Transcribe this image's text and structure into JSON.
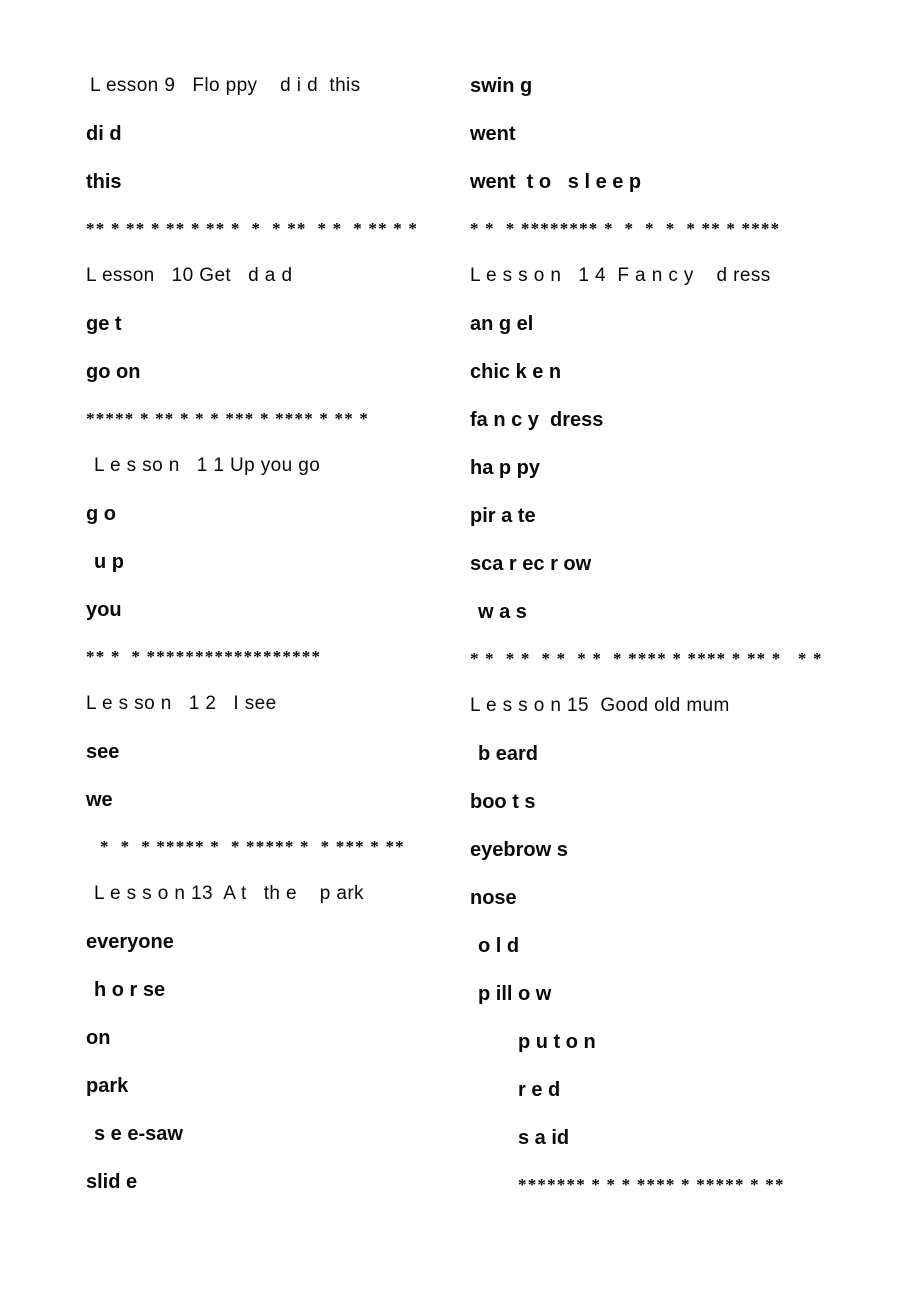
{
  "document": {
    "title": "Lesson word lists 9 to 15",
    "background_color": "#ffffff",
    "text_color": "#000000"
  },
  "columns": [
    {
      "name": "left-column",
      "lines": [
        {
          "kind": "heading",
          "indent": 1,
          "text": "L esson 9   Flo ppy    d i d  this"
        },
        {
          "kind": "word",
          "indent": 0,
          "text": "di d"
        },
        {
          "kind": "word",
          "indent": 0,
          "text": "this"
        },
        {
          "kind": "sep",
          "indent": 0,
          "text": "** * ** * ** * ** *  *  * **  * *  * ** * *"
        },
        {
          "kind": "heading",
          "indent": 0,
          "text": "L esson   10 Get   d a d"
        },
        {
          "kind": "word",
          "indent": 0,
          "text": "ge t"
        },
        {
          "kind": "word",
          "indent": 0,
          "text": "go on"
        },
        {
          "kind": "sep",
          "indent": 0,
          "text": "***** * ** * * * *** * **** * ** *"
        },
        {
          "kind": "heading",
          "indent": 2,
          "text": "L e s so n   1 1 Up you go"
        },
        {
          "kind": "word",
          "indent": 0,
          "text": "g o"
        },
        {
          "kind": "word",
          "indent": 2,
          "text": "u p"
        },
        {
          "kind": "word",
          "indent": 0,
          "text": "you"
        },
        {
          "kind": "sep",
          "indent": 0,
          "text": "** *  * ******************"
        },
        {
          "kind": "heading",
          "indent": 0,
          "text": "L e s so n   1 2   I see"
        },
        {
          "kind": "word",
          "indent": 0,
          "text": "see"
        },
        {
          "kind": "word",
          "indent": 0,
          "text": "we"
        },
        {
          "kind": "sep",
          "indent": 3,
          "text": "*  *  * ***** *  * ***** *  * *** * **"
        },
        {
          "kind": "heading",
          "indent": 2,
          "text": "L e s s o n 13  A t   th e    p ark"
        },
        {
          "kind": "word",
          "indent": 0,
          "text": "everyone"
        },
        {
          "kind": "word",
          "indent": 2,
          "text": "h o r se"
        },
        {
          "kind": "word",
          "indent": 0,
          "text": "on"
        },
        {
          "kind": "word",
          "indent": 0,
          "text": "park"
        },
        {
          "kind": "word",
          "indent": 2,
          "text": "s e e-saw"
        },
        {
          "kind": "word",
          "indent": 0,
          "text": "slid e"
        }
      ]
    },
    {
      "name": "right-column",
      "lines": [
        {
          "kind": "word",
          "indent": 0,
          "text": "swin g"
        },
        {
          "kind": "word",
          "indent": 0,
          "text": "went"
        },
        {
          "kind": "word",
          "indent": 0,
          "text": "went  t o   s l e e p"
        },
        {
          "kind": "sep",
          "indent": 0,
          "text": "* *  * ******** *  *  *  *  * ** * ****"
        },
        {
          "kind": "heading",
          "indent": 0,
          "text": "L e s s o n   1 4  F a n c y    d ress"
        },
        {
          "kind": "word",
          "indent": 0,
          "text": "an g el"
        },
        {
          "kind": "word",
          "indent": 0,
          "text": "chic k e n"
        },
        {
          "kind": "word",
          "indent": 0,
          "text": "fa n c y  dress"
        },
        {
          "kind": "word",
          "indent": 0,
          "text": "ha p py"
        },
        {
          "kind": "word",
          "indent": 0,
          "text": "pir a te"
        },
        {
          "kind": "word",
          "indent": 0,
          "text": "sca r ec r ow"
        },
        {
          "kind": "word",
          "indent": 2,
          "text": "w a s"
        },
        {
          "kind": "sep",
          "indent": 0,
          "text": "* *  * *  * *  * *  * **** * **** * ** *   * *"
        },
        {
          "kind": "heading",
          "indent": 0,
          "text": "L e s s o n 15  Good old mum"
        },
        {
          "kind": "word",
          "indent": 2,
          "text": "b eard"
        },
        {
          "kind": "word",
          "indent": 0,
          "text": "boo t s"
        },
        {
          "kind": "word",
          "indent": 0,
          "text": "eyebrow s"
        },
        {
          "kind": "word",
          "indent": 0,
          "text": "nose"
        },
        {
          "kind": "word",
          "indent": 2,
          "text": "o l d"
        },
        {
          "kind": "word",
          "indent": 2,
          "text": "p ill o w"
        },
        {
          "kind": "word",
          "indent": 9,
          "text": "p u t o n"
        },
        {
          "kind": "word",
          "indent": 9,
          "text": "r e d"
        },
        {
          "kind": "word",
          "indent": 9,
          "text": "s a id"
        },
        {
          "kind": "sep",
          "indent": 9,
          "text": "******* * * * **** * ***** * **"
        }
      ]
    }
  ]
}
